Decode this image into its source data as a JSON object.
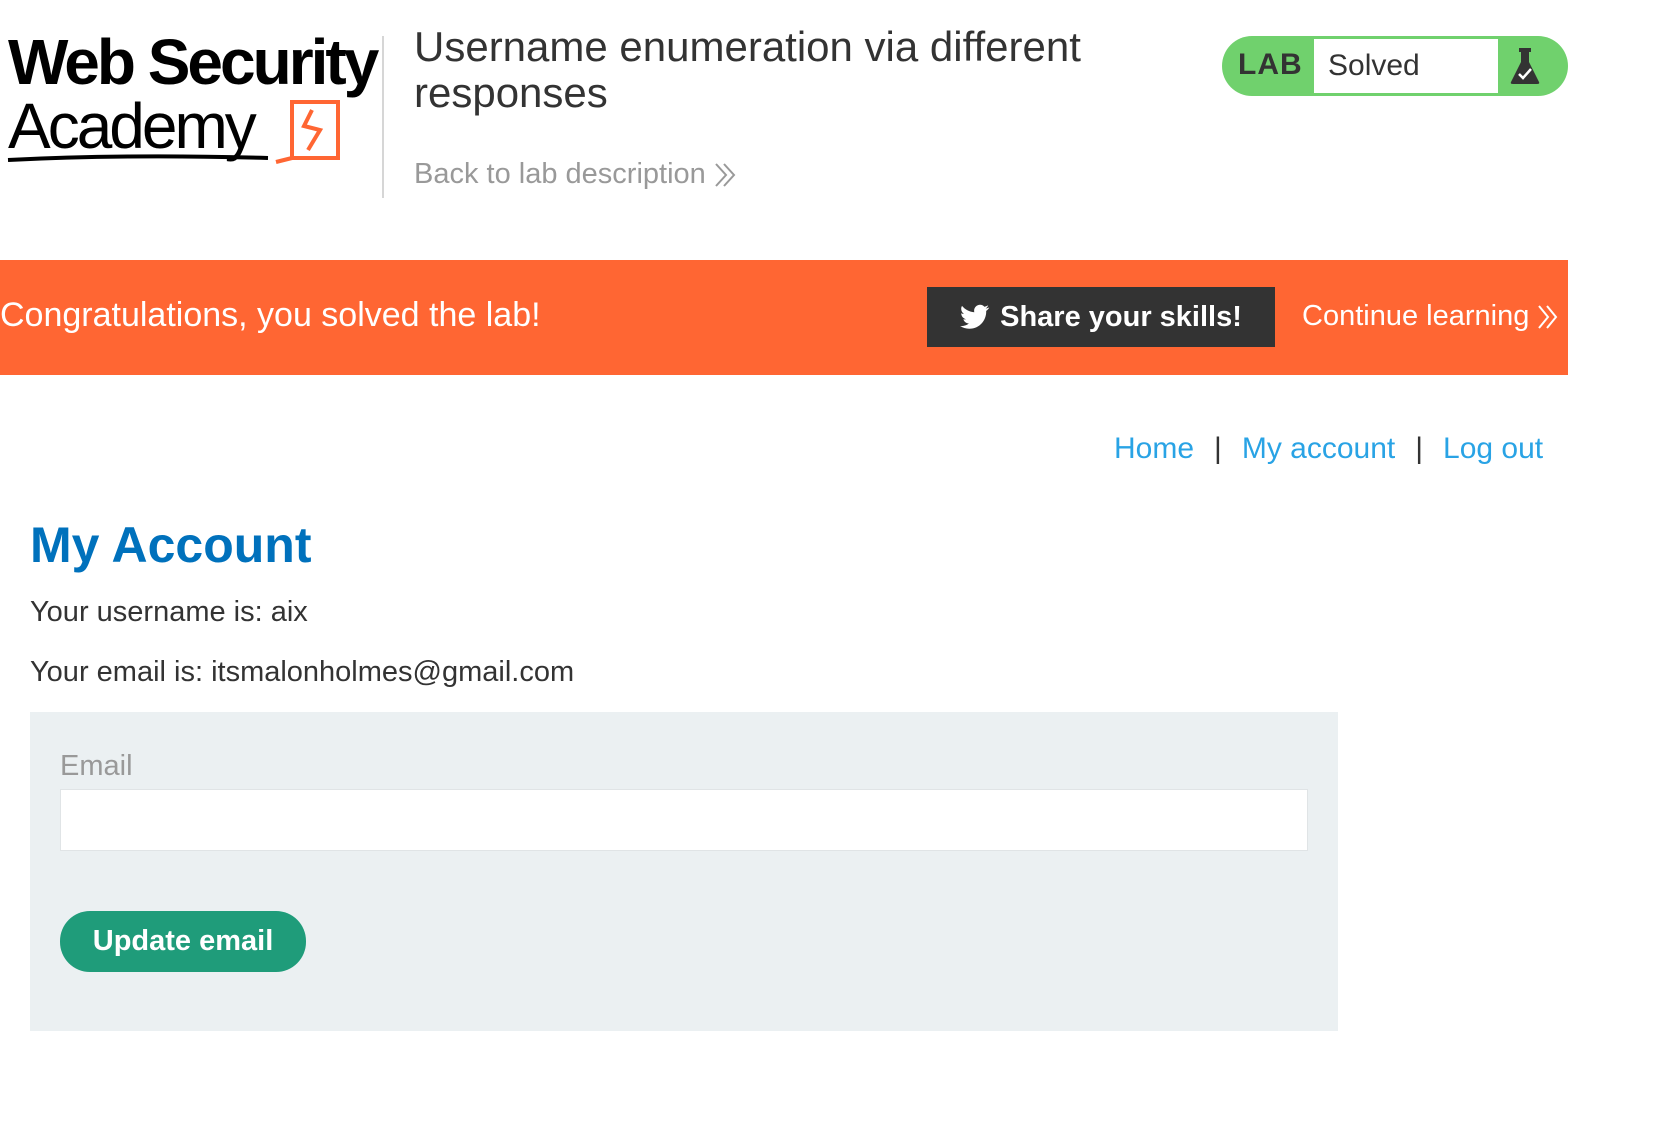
{
  "header": {
    "logo_line1": "Web Security",
    "logo_line2": "Academy",
    "lab_title": "Username enumeration via different responses",
    "back_link": "Back to lab description"
  },
  "status": {
    "badge": "LAB",
    "value": "Solved",
    "icon": "flask-check-icon",
    "color": "#70d16d"
  },
  "banner": {
    "message": "Congratulations, you solved the lab!",
    "share_label": "Share your skills!",
    "continue_label": "Continue learning",
    "color": "#ff6633"
  },
  "nav": {
    "home": "Home",
    "separator": "|",
    "my_account": "My account",
    "log_out": "Log out"
  },
  "main": {
    "title": "My Account",
    "username_line": "Your username is: aix",
    "email_line": "Your email is: itsmalonholmes@gmail.com"
  },
  "form": {
    "email_label": "Email",
    "email_value": "",
    "email_placeholder": "",
    "submit_label": "Update email",
    "button_color": "#1f9c7a"
  }
}
